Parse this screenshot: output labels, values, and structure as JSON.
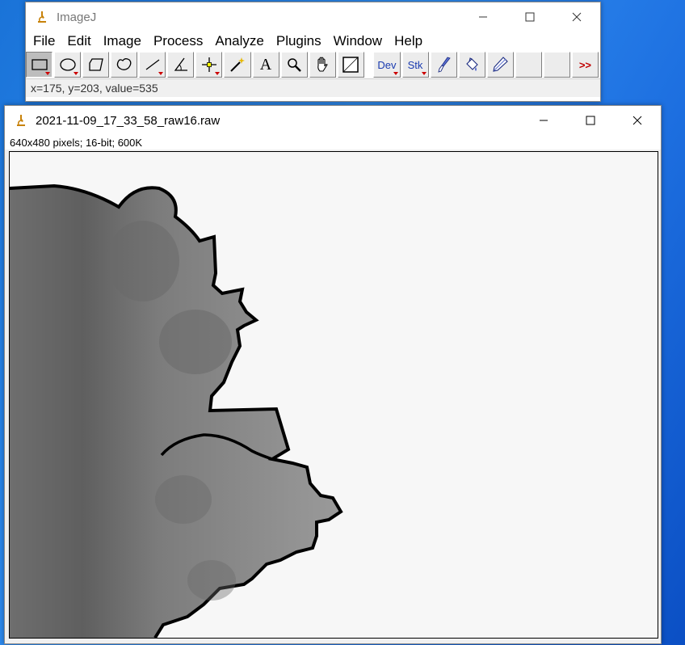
{
  "imagej": {
    "title": "ImageJ",
    "menus": [
      "File",
      "Edit",
      "Image",
      "Process",
      "Analyze",
      "Plugins",
      "Window",
      "Help"
    ],
    "toolbar": {
      "dev_label": "Dev",
      "stk_label": "Stk",
      "text_tool_label": "A",
      "more_label": ">>"
    },
    "status": "x=175, y=203, value=535"
  },
  "image_window": {
    "title": "2021-11-09_17_33_58_raw16.raw",
    "info": "640x480 pixels; 16-bit; 600K"
  },
  "colors": {
    "desktop": "#1d6fe0",
    "toolbar_bg": "#ececec",
    "image_bg": "#f7f7f7",
    "shape_fill": "#808080",
    "outline": "#000000",
    "more_arrow": "#c00000"
  }
}
